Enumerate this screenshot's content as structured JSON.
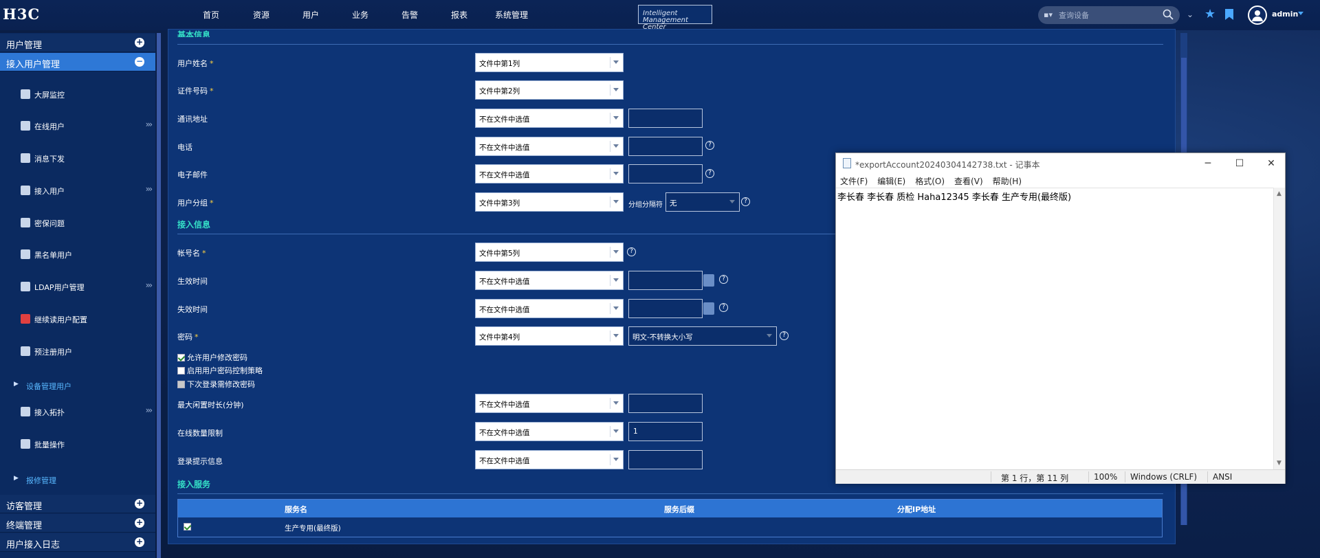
{
  "header": {
    "logo_mark": "H3C",
    "logo_line1": "Intelligent",
    "logo_line2": "Management Center",
    "nav": [
      "首页",
      "资源",
      "用户",
      "业务",
      "告警",
      "报表",
      "系统管理"
    ],
    "search_placeholder": "查询设备",
    "user": "admin"
  },
  "sidebar": {
    "sections_top": [
      {
        "label": "用户管理",
        "toggle": "+"
      },
      {
        "label": "接入用户管理",
        "toggle": "−"
      }
    ],
    "items": [
      {
        "label": "大屏监控",
        "arrow": ""
      },
      {
        "label": "在线用户",
        "arrow": "›››"
      },
      {
        "label": "消息下发",
        "arrow": ""
      },
      {
        "label": "接入用户",
        "arrow": "›››"
      },
      {
        "label": "密保问题",
        "arrow": ""
      },
      {
        "label": "黑名单用户",
        "arrow": ""
      },
      {
        "label": "LDAP用户管理",
        "arrow": "›››"
      },
      {
        "label": "继续读用户配置",
        "arrow": ""
      },
      {
        "label": "预注册用户",
        "arrow": ""
      }
    ],
    "sub1": "设备管理用户",
    "items2": [
      {
        "label": "接入拓扑",
        "arrow": "›››"
      },
      {
        "label": "批量操作",
        "arrow": ""
      }
    ],
    "sub2": "报修管理",
    "sections_bottom": [
      {
        "label": "访客管理",
        "toggle": "+"
      },
      {
        "label": "终端管理",
        "toggle": "+"
      },
      {
        "label": "用户接入日志",
        "toggle": "+"
      }
    ]
  },
  "form": {
    "section_basic": "基本信息",
    "basic": [
      {
        "label": "用户姓名",
        "req": "*",
        "select": "文件中第1列",
        "text": null,
        "help": false
      },
      {
        "label": "证件号码",
        "req": "*",
        "select": "文件中第2列",
        "text": null,
        "help": false
      },
      {
        "label": "通讯地址",
        "req": "",
        "select": "不在文件中选值",
        "text": "",
        "help": false
      },
      {
        "label": "电话",
        "req": "",
        "select": "不在文件中选值",
        "text": "",
        "help": true
      },
      {
        "label": "电子邮件",
        "req": "",
        "select": "不在文件中选值",
        "text": "",
        "help": true
      },
      {
        "label": "用户分组",
        "req": "*",
        "select": "文件中第3列",
        "text": null,
        "help": false
      }
    ],
    "group_sep_label": "分组分隔符",
    "group_sep_value": "无",
    "section_access": "接入信息",
    "access": [
      {
        "label": "帐号名",
        "req": "*",
        "select": "文件中第5列"
      },
      {
        "label": "生效时间",
        "req": "",
        "select": "不在文件中选值"
      },
      {
        "label": "失效时间",
        "req": "",
        "select": "不在文件中选值"
      },
      {
        "label": "密码",
        "req": "*",
        "select": "文件中第4列"
      }
    ],
    "password_mode": "明文-不转换大小写",
    "checkboxes": [
      {
        "label": "允许用户修改密码",
        "state": "checked"
      },
      {
        "label": "启用用户密码控制策略",
        "state": "unchecked"
      },
      {
        "label": "下次登录需修改密码",
        "state": "disabled"
      }
    ],
    "more": [
      {
        "label": "最大闲置时长(分钟)",
        "select": "不在文件中选值",
        "text": ""
      },
      {
        "label": "在线数量限制",
        "select": "不在文件中选值",
        "text": "1"
      },
      {
        "label": "登录提示信息",
        "select": "不在文件中选值",
        "text": ""
      }
    ],
    "section_service": "接入服务",
    "service_cols": [
      "服务名",
      "服务后缀",
      "分配IP地址"
    ],
    "service_row": {
      "checked": true,
      "name": "生产专用(最终版)",
      "suffix": "",
      "ip": ""
    }
  },
  "notepad": {
    "title": "*exportAccount20240304142738.txt - 记事本",
    "menu": [
      "文件(F)",
      "编辑(E)",
      "格式(O)",
      "查看(V)",
      "帮助(H)"
    ],
    "content": "李长春 李长春 质检 Haha12345 李长春 生产专用(最终版)",
    "status": {
      "pos": "第 1 行，第 11 列",
      "zoom": "100%",
      "eol": "Windows (CRLF)",
      "enc": "ANSI"
    }
  }
}
